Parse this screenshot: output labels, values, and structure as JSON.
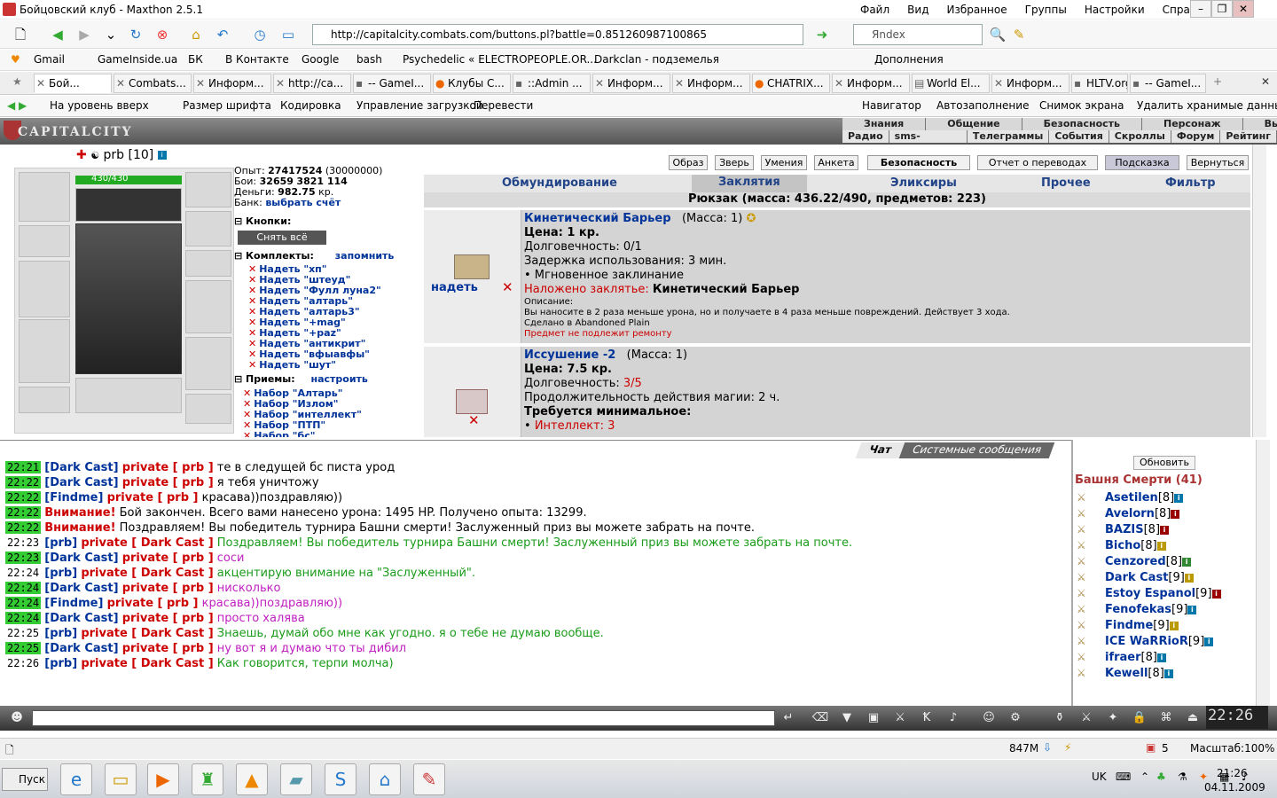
{
  "window": {
    "title": "Бойцовский клуб - Maxthon 2.5.1"
  },
  "menu": [
    "Файл",
    "Вид",
    "Избранное",
    "Группы",
    "Настройки",
    "Справка"
  ],
  "address": {
    "url": "http://capitalcity.combats.com/buttons.pl?battle=0.851260987100865",
    "search_placeholder": "Яndex"
  },
  "bookmarks": [
    "Gmail",
    "GameInside.ua",
    "БК",
    "В Контакте",
    "Google",
    "bash",
    "Psychedelic « ELECTROPEOPLE.OR...",
    "Darkclan - подземелья",
    "Дополнения"
  ],
  "tabs": [
    "Бой...",
    "Combats...",
    "Информ...",
    "http://ca...",
    "-- GameI...",
    "Клубы С...",
    "::Admin ...",
    "Информ...",
    "Информ...",
    "CHATRIX...",
    "Информ...",
    "World El...",
    "Информ...",
    "HLTV.org",
    "-- GameI..."
  ],
  "toolbar2": [
    "На уровень вверх",
    "Размер шрифта",
    "Кодировка",
    "Управление загрузкой",
    "Перевести",
    "Навигатор",
    "Автозаполнение",
    "Снимок экрана",
    "Удалить хранимые данные..."
  ],
  "game_nav": {
    "row1": [
      "Знания",
      "Общение",
      "Безопасность",
      "Персонаж",
      "Выход"
    ],
    "row2": [
      "Радио",
      "sms-история",
      "Телеграммы",
      "События",
      "Скроллы",
      "Форум",
      "Рейтинг"
    ],
    "logo": "CAPITALCITY"
  },
  "character": {
    "name": "prb",
    "level": "[10]",
    "hp": "430/430",
    "stats": [
      {
        "label": "Опыт:",
        "value": "27417524",
        "extra": "(30000000)"
      },
      {
        "label": "Бои:",
        "value": "32659",
        "extra": "3821   114"
      },
      {
        "label": "Деньги:",
        "value": "982.75",
        "extra": "кр."
      },
      {
        "label": "Банк:",
        "value": "выбрать счёт",
        "extra": ""
      }
    ]
  },
  "buttons_section": {
    "label": "Кнопки:",
    "remove_all": "Снять всё"
  },
  "sets_section": {
    "label": "Комплекты:",
    "action": "запомнить",
    "items": [
      "Надеть \"хп\"",
      "Надеть \"штеуд\"",
      "Надеть \"Фулл луна2\"",
      "Надеть \"алтарь\"",
      "Надеть \"алтарь3\"",
      "Надеть \"+mag\"",
      "Надеть \"+раz\"",
      "Надеть \"антикрит\"",
      "Надеть \"вфыавфы\"",
      "Надеть \"шут\""
    ]
  },
  "tricks_section": {
    "label": "Приемы:",
    "action": "настроить",
    "items": [
      "Набор \"Алтарь\"",
      "Набор \"Излом\"",
      "Набор \"интеллект\"",
      "Набор \"ПТП\"",
      "Набор \"бс\""
    ]
  },
  "top_buttons": [
    "Образ",
    "Зверь",
    "Умения",
    "Анкета",
    "Безопасность",
    "Отчет о переводах",
    "Подсказка",
    "Вернуться"
  ],
  "categories": [
    "Обмундирование",
    "Заклятия",
    "Эликсиры",
    "Прочее",
    "Фильтр"
  ],
  "backpack": "Рюкзак (масса: 436.22/490, предметов: 223)",
  "items": [
    {
      "action": "надеть",
      "name": "Кинетический Барьер",
      "mass": "(Масса: 1)",
      "price": "Цена: 1 кр.",
      "durability": "Долговечность: 0/1",
      "lines": [
        "Задержка использования: 3 мин.",
        "• Мгновенное заклинание"
      ],
      "spell_label": "Наложено заклятье:",
      "spell": "Кинетический Барьер",
      "desc_label": "Описание:",
      "desc": "Вы наносите в 2 раза меньше урона, но и получаете в 4 раза меньше повреждений. Действует 3 хода.",
      "made": "Сделано в Abandoned Plain",
      "norepair": "Предмет не подлежит ремонту"
    },
    {
      "name": "Иссушение -2",
      "mass": "(Масса: 1)",
      "price": "Цена: 7.5 кр.",
      "durability_label": "Долговечность:",
      "durability": "3/5",
      "lines": [
        "Продолжительность действия магии: 2 ч."
      ],
      "req": "Требуется минимальное:",
      "req_item": "Интеллект: 3"
    }
  ],
  "chat": {
    "tabs": [
      "Чат",
      "Системные сообщения"
    ],
    "lines": [
      {
        "time": "22:21",
        "hl": true,
        "from": "[Dark Cast]",
        "priv": "private [ prb ]",
        "text": "те в следущей бс писта урод",
        "color": "#000000"
      },
      {
        "time": "22:22",
        "hl": true,
        "from": "[Dark Cast]",
        "priv": "private [ prb ]",
        "text": "я тебя уничтожу",
        "color": "#000000"
      },
      {
        "time": "22:22",
        "hl": true,
        "from": "[Findme]",
        "priv": "private [ prb ]",
        "text": "красава))поздравляю))",
        "color": "#000000"
      },
      {
        "time": "22:22",
        "hl": true,
        "from": "",
        "priv": "Внимание!",
        "text": "Бой закончен. Всего вами нанесено урона: 1495 HP. Получено опыта: 13299.",
        "color": "#000000"
      },
      {
        "time": "22:22",
        "hl": true,
        "from": "",
        "priv": "Внимание!",
        "text": "Поздравляем! Вы победитель турнира Башни смерти! Заслуженный приз вы можете забрать на почте.",
        "color": "#000000"
      },
      {
        "time": "22:23",
        "hl": false,
        "from": "[prb]",
        "priv": "private [ Dark Cast ]",
        "text": "Поздравляем! Вы победитель турнира Башни смерти! Заслуженный приз вы можете забрать на почте.",
        "color": "#1a9c1a"
      },
      {
        "time": "22:23",
        "hl": true,
        "from": "[Dark Cast]",
        "priv": "private [ prb ]",
        "text": "соси",
        "color": "#c020c0"
      },
      {
        "time": "22:24",
        "hl": false,
        "from": "[prb]",
        "priv": "private [ Dark Cast ]",
        "text": "акцентирую внимание на \"Заслуженный\".",
        "color": "#1a9c1a"
      },
      {
        "time": "22:24",
        "hl": true,
        "from": "[Dark Cast]",
        "priv": "private [ prb ]",
        "text": "нисколько",
        "color": "#c020c0"
      },
      {
        "time": "22:24",
        "hl": true,
        "from": "[Findme]",
        "priv": "private [ prb ]",
        "text": "красава))поздравляю))",
        "color": "#c020c0"
      },
      {
        "time": "22:24",
        "hl": true,
        "from": "[Dark Cast]",
        "priv": "private [ prb ]",
        "text": "просто халява",
        "color": "#c020c0"
      },
      {
        "time": "22:25",
        "hl": false,
        "from": "[prb]",
        "priv": "private [ Dark Cast ]",
        "text": "Знаешь, думай обо мне как угодно. я о тебе не думаю вообще.",
        "color": "#1a9c1a"
      },
      {
        "time": "22:25",
        "hl": true,
        "from": "[Dark Cast]",
        "priv": "private [ prb ]",
        "text": "ну вот я и думаю что ты дибил",
        "color": "#c020c0"
      },
      {
        "time": "22:26",
        "hl": false,
        "from": "[prb]",
        "priv": "private [ Dark Cast ]",
        "text": "Как говорится, терпи молча)",
        "color": "#1a9c1a"
      }
    ]
  },
  "online": {
    "refresh": "Обновить",
    "title": "Башня Смерти (41)",
    "users": [
      {
        "name": "Asetilen",
        "level": "[8]"
      },
      {
        "name": "Avelorn",
        "level": "[8]"
      },
      {
        "name": "BAZIS",
        "level": "[8]"
      },
      {
        "name": "Bicho",
        "level": "[8]"
      },
      {
        "name": "Cenzored",
        "level": "[8]"
      },
      {
        "name": "Dark Cast",
        "level": "[9]"
      },
      {
        "name": "Estoy Espanol",
        "level": "[9]"
      },
      {
        "name": "Fenofekas",
        "level": "[9]"
      },
      {
        "name": "Findme",
        "level": "[9]"
      },
      {
        "name": "ICE WaRRioR",
        "level": "[9]"
      },
      {
        "name": "ifraer",
        "level": "[8]"
      },
      {
        "name": "Kewell",
        "level": "[8]"
      }
    ]
  },
  "clock": "22:26",
  "statusbar": {
    "mem": "847M",
    "zoom": "Масштаб:100%",
    "count": "5"
  },
  "taskbar": {
    "start": "Пуск",
    "lang": "UK",
    "time": "21:26",
    "date": "04.11.2009"
  }
}
